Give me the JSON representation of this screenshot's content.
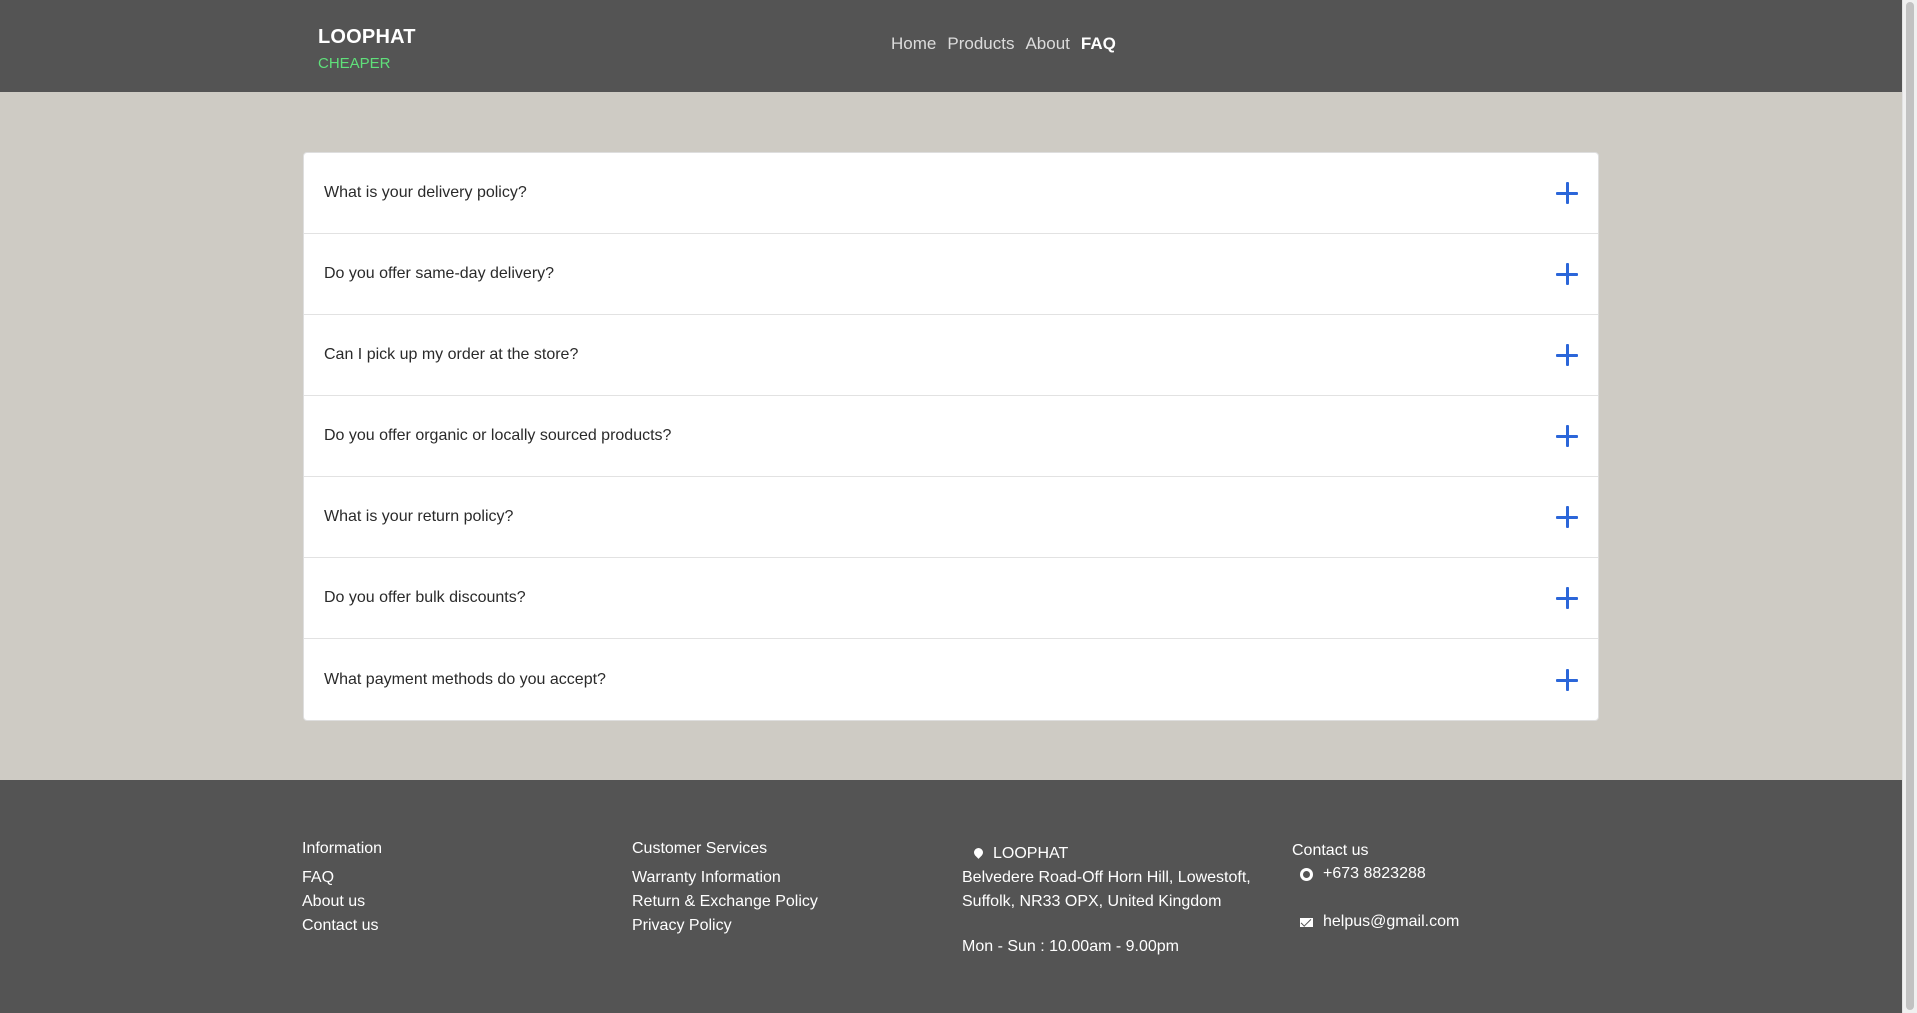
{
  "header": {
    "brand_name": "LOOPHAT",
    "brand_tag": "CHEAPER",
    "nav": [
      {
        "label": "Home"
      },
      {
        "label": "Products"
      },
      {
        "label": "About"
      },
      {
        "label": "FAQ"
      }
    ]
  },
  "faq": {
    "items": [
      {
        "question": "What is your delivery policy?"
      },
      {
        "question": "Do you offer same-day delivery?"
      },
      {
        "question": "Can I pick up my order at the store?"
      },
      {
        "question": "Do you offer organic or locally sourced products?"
      },
      {
        "question": "What is your return policy?"
      },
      {
        "question": "Do you offer bulk discounts?"
      },
      {
        "question": "What payment methods do you accept?"
      }
    ]
  },
  "footer": {
    "information": {
      "title": "Information",
      "links": [
        "FAQ",
        "About us",
        "Contact us"
      ]
    },
    "customer_services": {
      "title": "Customer Services",
      "links": [
        "Warranty Information",
        "Return & Exchange Policy",
        "Privacy Policy"
      ]
    },
    "location": {
      "name": "LOOPHAT",
      "address": "Belvedere Road-Off Horn Hill, Lowestoft, Suffolk,  NR33 OPX, United Kingdom",
      "hours": "Mon - Sun : 10.00am - 9.00pm"
    },
    "contact": {
      "title": "Contact us",
      "phone": "+673 8823288",
      "email": "helpus@gmail.com"
    }
  },
  "colors": {
    "header_bg": "#545454",
    "page_bg": "#cecbc4",
    "brand_accent": "#5fe07a",
    "icon_accent": "#2b66d9"
  }
}
